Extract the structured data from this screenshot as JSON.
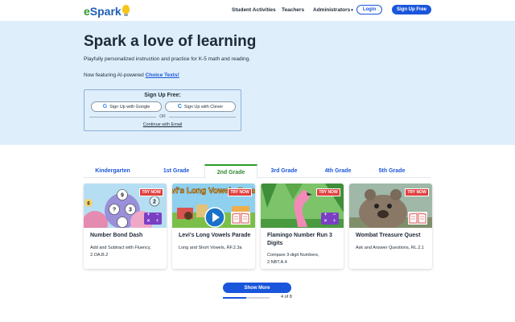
{
  "header": {
    "logo_e": "e",
    "logo_spark": "Spark",
    "nav": [
      "Student Activities",
      "Teachers",
      "Administrators"
    ],
    "login_label": "Login",
    "signup_label": "Sign Up Free"
  },
  "hero": {
    "title": "Spark a love of learning",
    "subtitle": "Playfully personalized instruction and practice for K-5 math and reading.",
    "featuring_prefix": "Now featuring AI-powered ",
    "featuring_link": "Choice Texts!",
    "signup_box": {
      "title": "Sign Up Free:",
      "google_label": "Sign Up with Google",
      "clever_label": "Sign Up with Clever",
      "or_label": "OR",
      "email_label": "Continue with Email"
    }
  },
  "tabs": [
    {
      "label": "Kindergarten",
      "active": false
    },
    {
      "label": "1st Grade",
      "active": false
    },
    {
      "label": "2nd Grade",
      "active": true
    },
    {
      "label": "3rd Grade",
      "active": false
    },
    {
      "label": "4th Grade",
      "active": false
    },
    {
      "label": "5th Grade",
      "active": false
    }
  ],
  "cards": [
    {
      "try_label": "TRY NOW",
      "title": "Number Bond Dash",
      "description": "Add and Subtract with Fluency, 2.OA.B.2",
      "image_numbers": [
        "9",
        "2",
        "?",
        "3",
        "6"
      ],
      "badge_symbols": [
        "+",
        "−",
        "×",
        "÷"
      ]
    },
    {
      "try_label": "TRY NOW",
      "title": "Levi's Long Vowels Parade",
      "description": "Long and Short Vowels, RF.2.3a",
      "image_text": "Levi's Long Vowels Parade"
    },
    {
      "try_label": "TRY NOW",
      "title": "Flamingo Number Run 3 Digits",
      "description": "Compare 3-digit Numbers, 2.NBT.A.4",
      "badge_symbols": [
        "+",
        "−",
        "×",
        "÷"
      ]
    },
    {
      "try_label": "TRY NOW",
      "title": "Wombat Treasure Quest",
      "description": "Ask and Answer Questions, RL.2.1"
    }
  ],
  "pager": {
    "show_more_label": "Show More",
    "page_text": "4 of 8",
    "progress": 0.5
  },
  "colors": {
    "brand_blue": "#1a56db",
    "brand_green": "#2f9a2f",
    "hero_bg": "#deeefb",
    "try_red": "#e04040"
  }
}
